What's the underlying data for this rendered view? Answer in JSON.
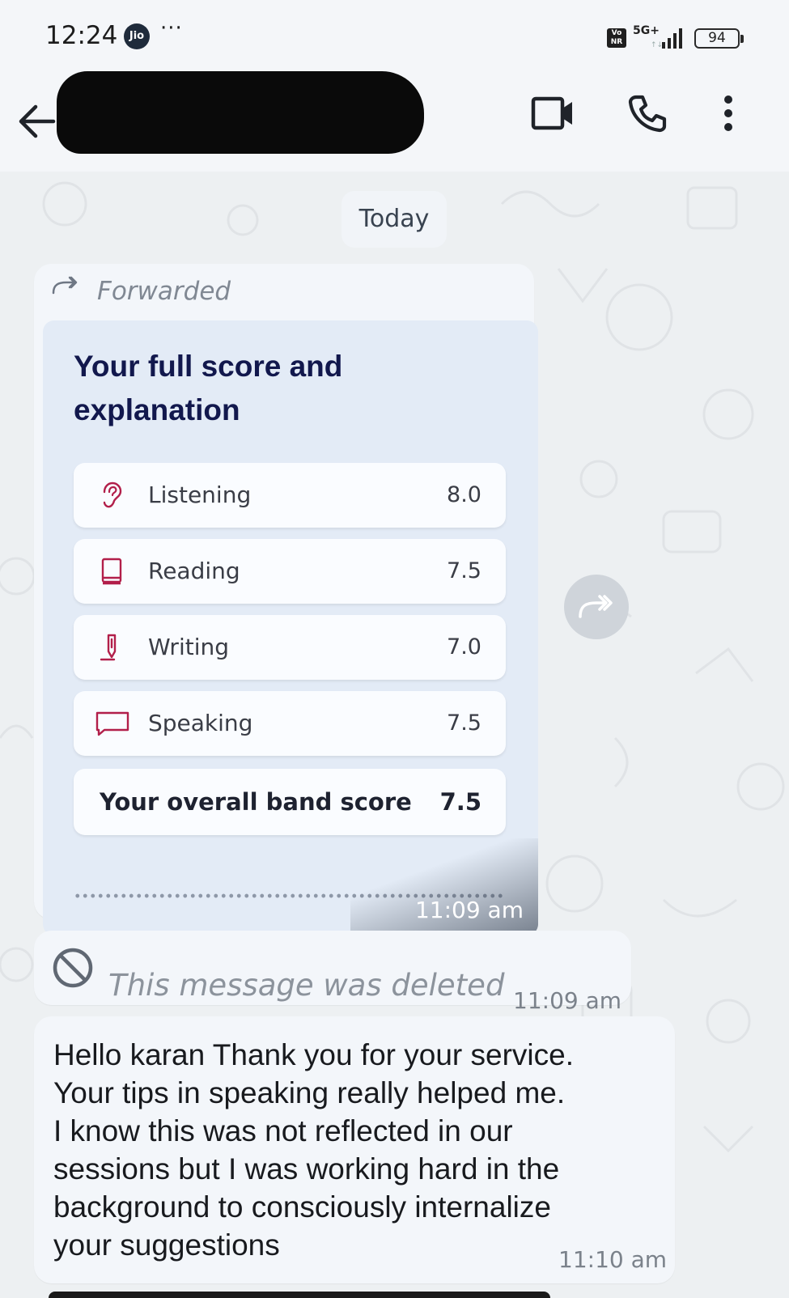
{
  "status_bar": {
    "time": "12:24",
    "carrier_badge": "Jio",
    "more": "···",
    "volte": "Vo NR",
    "network": "5G+",
    "battery": "94"
  },
  "header": {
    "contact_name": "",
    "icons": [
      "back-arrow-icon",
      "video-call-icon",
      "phone-icon",
      "more-vert-icon"
    ]
  },
  "chat": {
    "date_chip": "Today",
    "forwarded_label": "Forwarded",
    "score_card": {
      "title": "Your full score and explanation",
      "rows": [
        {
          "label": "Listening",
          "score": "8.0",
          "icon": "ear-icon"
        },
        {
          "label": "Reading",
          "score": "7.5",
          "icon": "book-icon"
        },
        {
          "label": "Writing",
          "score": "7.0",
          "icon": "pen-icon"
        },
        {
          "label": "Speaking",
          "score": "7.5",
          "icon": "speech-bubble-icon"
        }
      ],
      "overall_label": "Your overall band score",
      "overall_score": "7.5",
      "time": "11:09 am"
    },
    "deleted_message": {
      "text": "This message was deleted",
      "time": "11:09 am"
    },
    "text_message": {
      "lines": [
        "Hello karan Thank you for your service.",
        "Your tips in speaking really helped me.",
        "I know this was not reflected in our",
        "sessions but I was working hard in the",
        "background to consciously internalize",
        "your suggestions"
      ],
      "time": "11:10 am"
    }
  },
  "colors": {
    "title_navy": "#12184d",
    "icon_accent": "#b21f4a",
    "chat_bg": "#edf0f2",
    "bubble": "#f3f6fa"
  }
}
